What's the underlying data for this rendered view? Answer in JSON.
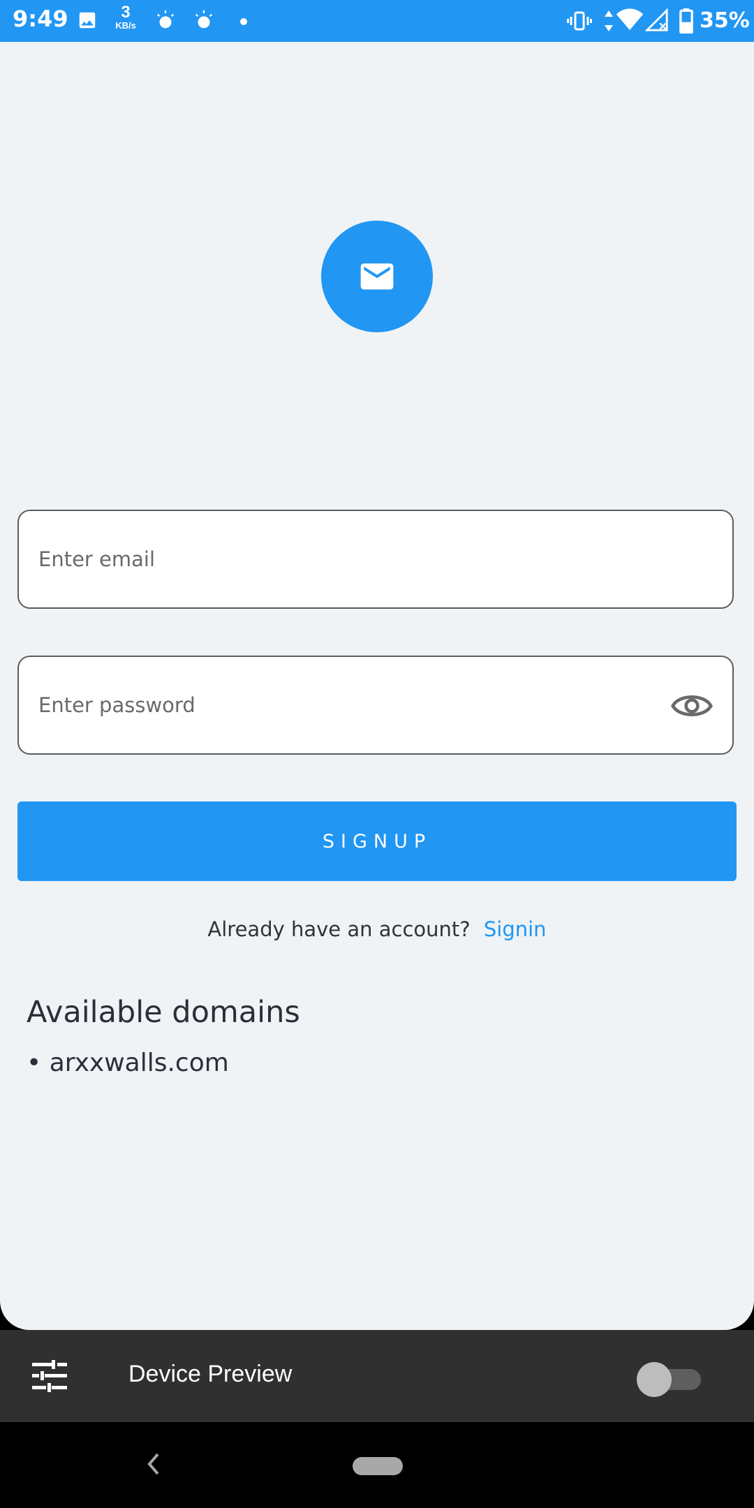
{
  "status_bar": {
    "time": "9:49",
    "net_speed_value": "3",
    "net_speed_unit": "KB/s",
    "battery": "35%",
    "icons": [
      "image-icon",
      "speed-icon",
      "brightness-icon",
      "brightness-icon",
      "dot-icon",
      "vibrate-icon",
      "data-arrows-icon",
      "wifi-icon",
      "signal-icon",
      "battery-icon"
    ]
  },
  "app": {
    "logo_icon": "mail-icon",
    "email": {
      "value": "",
      "placeholder": "Enter email"
    },
    "password": {
      "value": "",
      "placeholder": "Enter password",
      "toggle_icon": "eye-icon"
    },
    "signup_label": "SIGNUP",
    "account_prompt": "Already have an account?",
    "signin_label": "Signin",
    "domains_title": "Available domains",
    "domains": [
      "arxxwalls.com"
    ],
    "accent_color": "#2196F3"
  },
  "preview_bar": {
    "icon": "tune-icon",
    "label": "Device Preview",
    "toggle_on": false
  },
  "nav_bar": {
    "back_icon": "back-chevron-icon",
    "home_icon": "home-pill"
  }
}
